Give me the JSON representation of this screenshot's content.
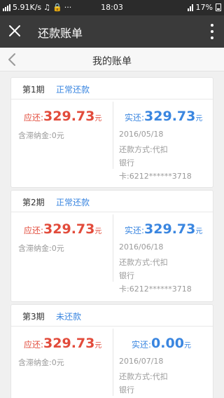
{
  "status_bar": {
    "speed": "5.91K/s",
    "extra": "···",
    "time": "18:03",
    "battery": "17%"
  },
  "app_bar": {
    "title": "还款账单"
  },
  "header": {
    "title": "我的账单"
  },
  "labels": {
    "due": "应还:",
    "paid": "实还:",
    "unit": "元",
    "late_fee_prefix": "含滞纳金:",
    "method_prefix": "还款方式:",
    "card_prefix": "卡:"
  },
  "periods": [
    {
      "period": "第1期",
      "status": "正常还款",
      "due_amount": "329.73",
      "late_fee": "0元",
      "paid_amount": "329.73",
      "date": "2016/05/18",
      "method": "代扣",
      "channel": "银行",
      "card": "6212******3718"
    },
    {
      "period": "第2期",
      "status": "正常还款",
      "due_amount": "329.73",
      "late_fee": "0元",
      "paid_amount": "329.73",
      "date": "2016/06/18",
      "method": "代扣",
      "channel": "银行",
      "card": "6212******3718"
    },
    {
      "period": "第3期",
      "status": "未还款",
      "due_amount": "329.73",
      "late_fee": "0元",
      "paid_amount": "0.00",
      "date": "2016/07/18",
      "method": "代扣",
      "channel": "银行"
    }
  ]
}
